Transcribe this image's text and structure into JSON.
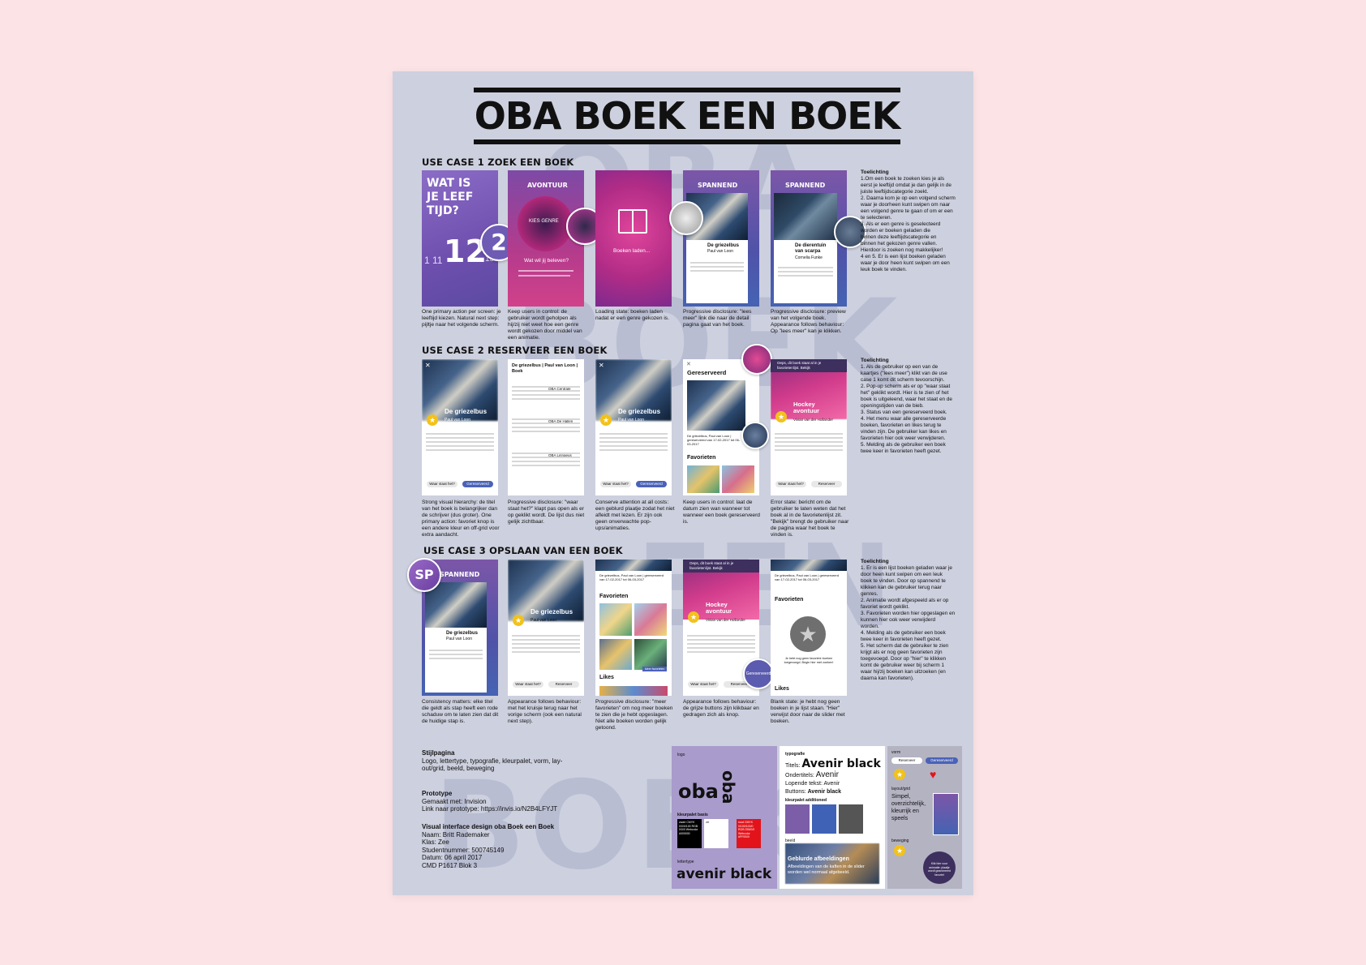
{
  "poster": {
    "title": "OBA BOEK EEN BOEK",
    "bg_words": [
      "OBA",
      "BOEK",
      "EEN",
      "BOEK"
    ]
  },
  "use_case_1": {
    "heading": "USE CASE 1 ZOEK EEN BOEK",
    "screens": [
      {
        "title": "WAT IS JE LEEF TIJD?",
        "numbers": [
          "12",
          "2"
        ],
        "side_numbers": [
          "1 11",
          "13"
        ]
      },
      {
        "title": "AVONTUUR",
        "label": "KIES GENRE",
        "question": "Wat wil jij beleven?"
      },
      {
        "label": "Boeken laden..."
      },
      {
        "title": "SPANNEND",
        "book": "De griezelbus",
        "author": "Paul van Loon"
      },
      {
        "title": "SPANNEND",
        "book": "De dierentuin van scarpa",
        "author": "Cornelia Funke"
      }
    ],
    "captions": [
      "One primary action per screen: je leeftijd kiezen. Natural next step: pijltje naar het volgende scherm.",
      "Keep users in control: de gebruiker wordt geholpen als hij/zij niet weet hoe een genre wordt gekozen door middel van een animatie.",
      "Loading state: boeken laden nadat er een genre gekozen is.",
      "Progressive disclosure: \"lees meer\" link die naar de detail pagina gaat van het boek.",
      "Progressive disclosure: preview van het volgende boek. Appearance follows behaviour: Op \"lees meer\" kan je klikken."
    ],
    "toelichting_title": "Toelichting",
    "toelichting": [
      "1.Om een boek te zoeken kies je als",
      "eerst je leeftijd omdat je dan gelijk in de",
      "juiste leeftijdscategorie zoekt.",
      "2. Daarna kom je op een volgend scherm",
      "waar je doorheen kunt swipen om naar",
      "een volgend genre te gaan of om er een",
      "te selecteren.",
      "3. Als er een genre is geselecteerd",
      "worden er boeken geladen die",
      "binnen deze leeftijdscategorie en",
      "binnen het gekozen genre vallen.",
      "Hierdoor is zoeken nog makkelijker!",
      "4 en 5. Er is een lijst boeken geladen",
      "waar je door heen kunt swipen om een",
      "leuk boek te vinden."
    ]
  },
  "use_case_2": {
    "heading": "USE CASE 2 RESERVEER EEN BOEK",
    "screens": [
      {
        "book": "De griezelbus",
        "author": "Paul van Loon",
        "btn1": "Waar staat het?",
        "btn2": "Gereserveerd"
      },
      {
        "header": "De griezelbus | Paul van Loon | Boek",
        "library1": "OBA Centrale",
        "library2": "OBA De Hallen",
        "library3": "OBA Linnaeus"
      },
      {
        "book": "De griezelbus",
        "author": "Paul van Loon",
        "btn1": "Waar staat het?",
        "btn2": "Gereserveerd"
      },
      {
        "title": "Gereserveerd",
        "sub": "De griezelbus, Paul van Loon | gereserveerd van 17-02-2017 tot 06-03-2017",
        "section": "Favorieten"
      },
      {
        "alert": "Oeps, dit boek staat al in je favorietenlijst. Bekijk",
        "book": "Hockey avontuur",
        "author": "Vivian van der Hollander",
        "btn1": "Waar staat het?",
        "btn2": "Reserveer"
      }
    ],
    "captions": [
      "Strong visual hierarchy: de titel van het boek is belangrijker dan de schrijver (dus groter). One primary action: favoriet knop is een andere kleur en off-grid voor extra aandacht.",
      "Progressive disclosure: \"waar staat het?\" klapt pas open als er op geklikt wordt. De lijst dus niet gelijk zichtbaar.",
      "Conserve attention at all costs: een geblurd plaatje zodat het niet afleidt met lezen. Er zijn ook geen onverwachte pop-ups/animaties.",
      "Keep users in control: laat de datum zien wan wanneer tot wanneer een boek gereserveerd is.",
      "Error state: bericht om de gebruiker te laten weten dat het boek al in de favorietenlijst zit. \"Bekijk\" brengt de gebruiker naar de pagina waar het boek te vinden is."
    ],
    "toelichting_title": "Toelichting",
    "toelichting": [
      "1. Als de gebruiker op een van de",
      "kaartjes (\"lees meer\") klikt van de use",
      "case 1 komt dit scherm tevoorschijn.",
      "2. Pop-up scherm als er op \"waar staat",
      "het\" geklikt wordt. Hier is te zien of het",
      "boek is uitgeleend, waar het staat en de",
      "openingstijden van de bieb.",
      "3. Status van een gereserveerd boek.",
      "4. Het menu waar alle gereserveerde",
      "boeken, favorieten en likes terug te",
      "vinden zijn. De gebruiker kan likes en",
      "favorieten hier ook weer verwijderen.",
      "5. Melding als de gebruiker een boek",
      "twee keer in favorieten heeft gezet."
    ]
  },
  "use_case_3": {
    "heading": "USE CASE 3 OPSLAAN VAN EEN BOEK",
    "screens": [
      {
        "badge": "SP",
        "title": "SPANNEND",
        "book": "De griezelbus",
        "author": "Paul van Loon"
      },
      {
        "book": "De griezelbus",
        "author": "Paul van Loon",
        "btn1": "Waar staat het?",
        "btn2": "Reserveer"
      },
      {
        "sub": "De griezelbus, Paul van Loon | gereserveerd van 17-02-2017 tot 06-03-2017",
        "section1": "Favorieten",
        "section2": "Likes",
        "tag": "Meer favorieten"
      },
      {
        "alert": "Oeps, dit boek staat al in je favorietenlijst. Bekijk",
        "book": "Hockey avontuur",
        "author": "Vivian van der Hollander",
        "btn1": "Waar staat het?",
        "btn2": "Reserveer",
        "bubble": "Gereserveerd"
      },
      {
        "sub": "De griezelbus, Paul van Loon | gereserveerd van 17-02-2017 tot 06-03-2017",
        "section1": "Favorieten",
        "empty": "Je hebt nog geen favoriete boeken toegevoegd. Begin hier met zoeken!",
        "section2": "Likes"
      }
    ],
    "captions": [
      "Consistency matters: elke titel die geldt als stap heeft een rode schaduw om te laten zien dat dit de huidige stap is.",
      "Appearance follows behaviour: met het kruisje terug naar het vorige scherm (ook een natural next step).",
      "Progressive disclosure: \"meer favorieten\" om nog meer boeken te zien die je hebt opgeslagen. Niet alle boeken worden gelijk getoond.",
      "Appearance follows behaviour: de grijze buttons zijn klikbaar en gedragen zich als knop.",
      "Blank state: je hebt nog geen boeken in je lijst staan. \"Hier\" verwijst door naar de slider met boeken."
    ],
    "toelichting_title": "Toelichting",
    "toelichting": [
      "1. Er is een lijst boeken geladen waar je",
      "door heen kunt swipen om een leuk",
      "boek te vinden. Door op spannend te",
      "klikken kan de gebruiker terug naar",
      "genres.",
      "2. Animatie wordt afgespeeld als er op",
      "favoriet wordt geklikt.",
      "3. Favorieten worden hier opgeslagen en",
      "kunnen hier ook weer verwijderd",
      "worden.",
      "4. Melding als de gebruiker een boek",
      "twee keer in favorieten heeft gezet.",
      "5. Het scherm dat de gebruiker te zien",
      "krijgt als er nog geen favorieten zijn",
      "toegevoegd. Door op \"hier\" te klikken",
      "komt de gebruiker weer bij scherm 1",
      "waar hij/zij boeken kan uitzoeken (en",
      "daarna kan favorieten)."
    ]
  },
  "info": {
    "stijl_title": "Stijlpagina",
    "stijl_text": [
      "Logo, lettertype, typografie, kleurpalet, vorm, lay-",
      "out/grid, beeld, beweging"
    ],
    "prototype_title": "Prototype",
    "prototype_text": [
      "Gemaakt met: Invision",
      "Link naar prototype: https://invis.io/N2B4LFYJT"
    ],
    "design_title": "Visual interface design oba Boek een Boek",
    "design_text": [
      "Naam: Britt Rademaker",
      "Klas: Zee",
      "Studentnummer: 500745149",
      "Datum: 06 april 2017",
      "CMD P1617 Blok 3"
    ]
  },
  "style_panel": {
    "logo_label": "logo",
    "logo_text": "oba",
    "kleurpalet_basis": "kleurpalet basis",
    "swatch_black": "zwart CMYK 0/0/0/100 RGB 0/0/0 Webcolor #000000",
    "swatch_white": "wit",
    "swatch_red": "rood CMYK 0/100/100/0 RGB 255/0/0 Webcolor #FF0000",
    "lettertype_label": "lettertype",
    "lettertype": "avenir black",
    "typografie_label": "typografie",
    "titels_label": "Titels:",
    "titels_value": "Avenir black",
    "ondertitels": "Ondertitels:",
    "ondertitels_value": "Avenir",
    "lopende_tekst": "Lopende tekst: Avenir",
    "buttons": "Buttons:",
    "buttons_value": "Avenir black",
    "kleurpalet_extra": "kleurpalet additioneel",
    "beeld_label": "beeld",
    "beeld_title": "Geblurde afbeeldingen",
    "beeld_text": "Afbeeldingen van de kaften in de slider worden wel normaal afgebeeld.",
    "vorm_label": "vorm",
    "btn_reserveer": "Reserveer",
    "btn_gereserveerd": "Gereserveerd",
    "layout_label": "layout/grid",
    "layout_text": [
      "Simpel,",
      "overzichtelijk,",
      "kleurrijk en",
      "speels"
    ],
    "beweging_label": "beweging",
    "beweging_text": "Klik hier voor animatie: plaatje wordt geanimeerd favoriet"
  },
  "colors": {
    "page_bg": "#fce3e6",
    "poster_bg": "#cdd0de",
    "purple": "#7b5ea7",
    "magenta": "#c9307e",
    "blue": "#3f62b6",
    "star": "#f2c21b",
    "red": "#e3131b"
  }
}
